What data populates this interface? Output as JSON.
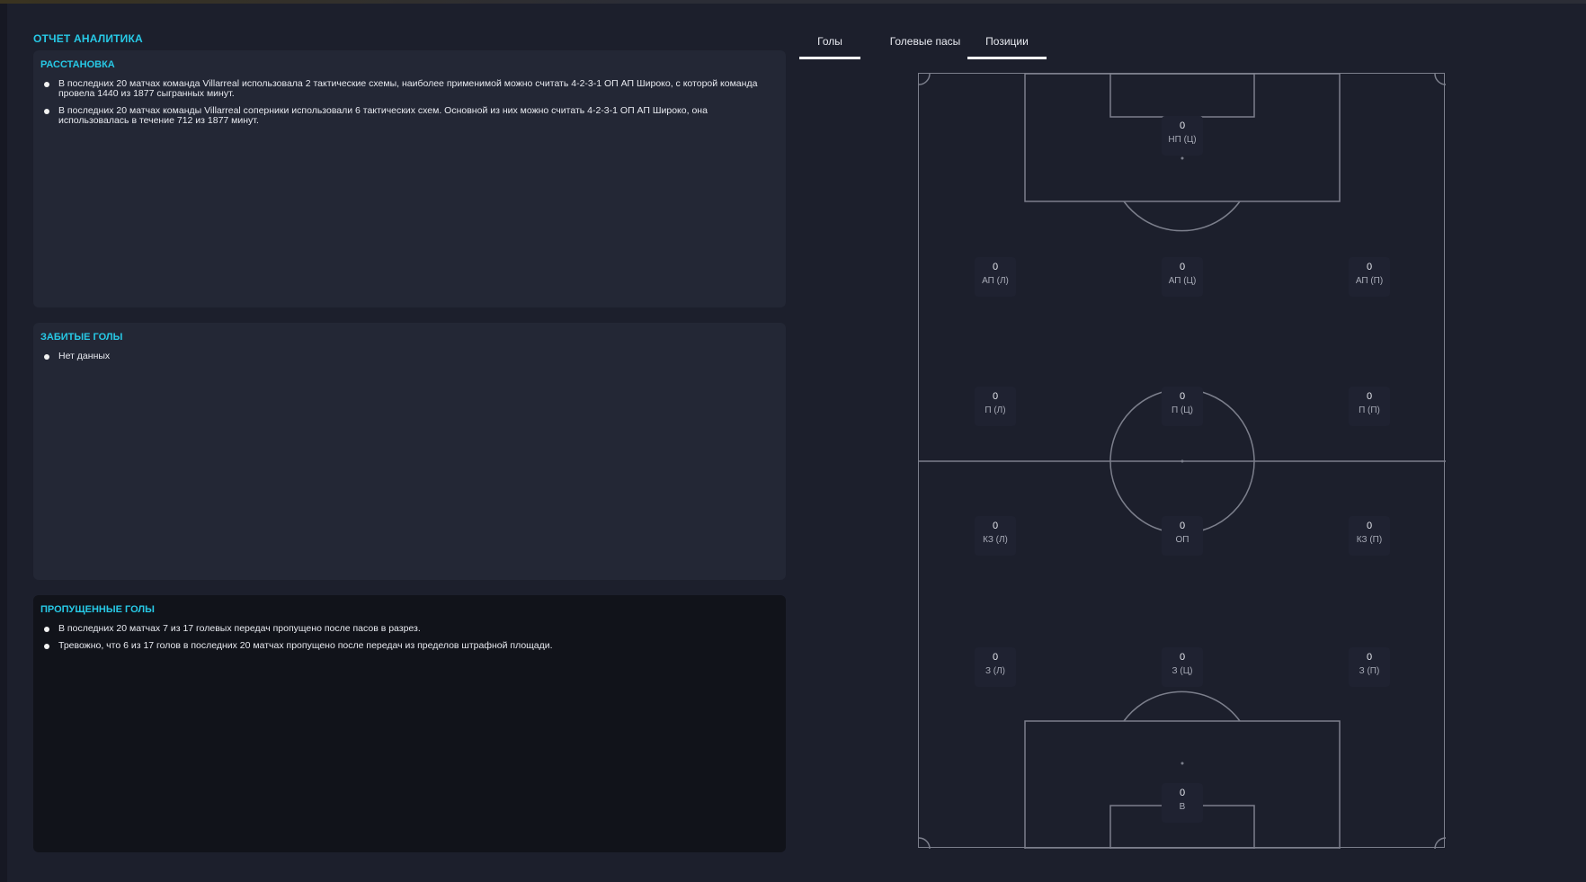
{
  "report": {
    "title": "ОТЧЕТ АНАЛИТИКА",
    "sections": [
      {
        "title": "РАССТАНОВКА",
        "bullets": [
          "В последних 20 матчах команда Villarreal использовала 2 тактические схемы, наиболее применимой можно считать 4-2-3-1 ОП АП Широко, с которой команда провела 1440 из 1877 сыгранных минут.",
          "В последних 20 матчах команды Villarreal соперники использовали 6 тактических схем. Основной из них можно считать 4-2-3-1 ОП АП Широко, она использовалась в течение 712 из 1877 минут."
        ]
      },
      {
        "title": "ЗАБИТЫЕ ГОЛЫ",
        "bullets": [
          "Нет данных"
        ]
      },
      {
        "title": "ПРОПУЩЕННЫЕ ГОЛЫ",
        "bullets": [
          "В последних 20 матчах 7 из 17 голевых передач пропущено после пасов в разрез.",
          "Тревожно, что 6 из 17 голов в последних 20 матчах пропущено после передач из пределов штрафной площади."
        ]
      }
    ]
  },
  "tabs": [
    {
      "label": "Голы",
      "active": true
    },
    {
      "label": "Голевые пасы",
      "active": false
    },
    {
      "label": "Позиции",
      "active": true
    }
  ],
  "positions": [
    {
      "label": "НП (Ц)",
      "value": "0"
    },
    {
      "label": "АП (Л)",
      "value": "0"
    },
    {
      "label": "АП (Ц)",
      "value": "0"
    },
    {
      "label": "АП (П)",
      "value": "0"
    },
    {
      "label": "П (Л)",
      "value": "0"
    },
    {
      "label": "П (Ц)",
      "value": "0"
    },
    {
      "label": "П (П)",
      "value": "0"
    },
    {
      "label": "КЗ (Л)",
      "value": "0"
    },
    {
      "label": "ОП",
      "value": "0"
    },
    {
      "label": "КЗ (П)",
      "value": "0"
    },
    {
      "label": "З (Л)",
      "value": "0"
    },
    {
      "label": "З (Ц)",
      "value": "0"
    },
    {
      "label": "З (П)",
      "value": "0"
    },
    {
      "label": "В",
      "value": "0"
    }
  ],
  "colors": {
    "accent": "#27c9e6",
    "background": "#1c1f2c",
    "card": "#232735",
    "card_dark": "#11131a",
    "pitch_line": "#7c7f8c"
  }
}
